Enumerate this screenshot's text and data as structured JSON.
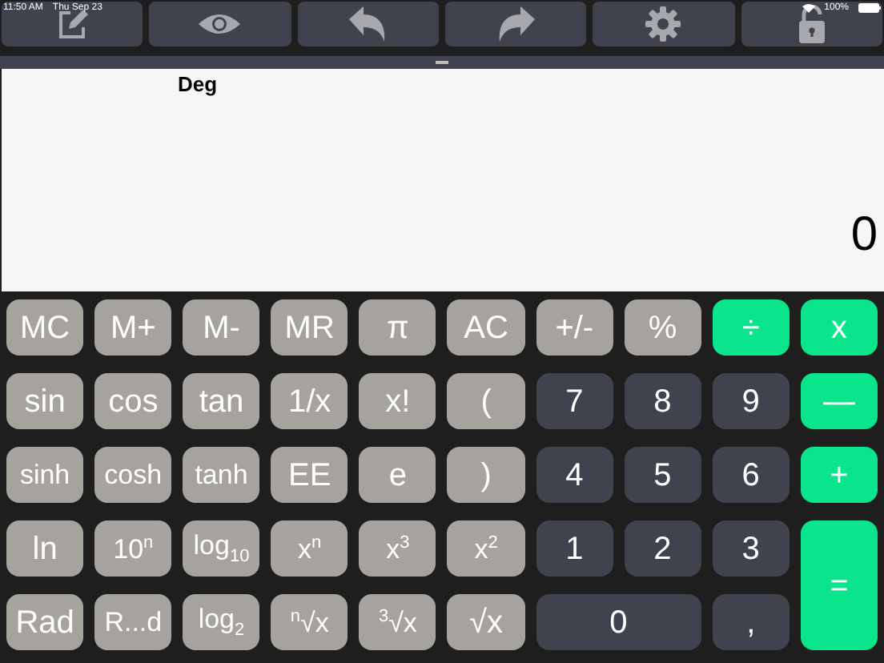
{
  "status_bar": {
    "time": "11:50 AM",
    "date": "Thu Sep 23",
    "battery": "100%"
  },
  "display": {
    "mode": "Deg",
    "value": "0"
  },
  "keys": [
    {
      "label": "MC",
      "kind": "func"
    },
    {
      "label": "M+",
      "kind": "func"
    },
    {
      "label": "M-",
      "kind": "func"
    },
    {
      "label": "MR",
      "kind": "func"
    },
    {
      "label": "π",
      "kind": "func"
    },
    {
      "label": "AC",
      "kind": "func"
    },
    {
      "label": "+/-",
      "kind": "func"
    },
    {
      "label": "%",
      "kind": "func"
    },
    {
      "label": "÷",
      "kind": "op"
    },
    {
      "label": "x",
      "kind": "op"
    },
    {
      "label": "sin",
      "kind": "func"
    },
    {
      "label": "cos",
      "kind": "func"
    },
    {
      "label": "tan",
      "kind": "func"
    },
    {
      "label": "1/x",
      "kind": "func"
    },
    {
      "label": "x!",
      "kind": "func"
    },
    {
      "label": "(",
      "kind": "func"
    },
    {
      "label": "7",
      "kind": "num"
    },
    {
      "label": "8",
      "kind": "num"
    },
    {
      "label": "9",
      "kind": "num"
    },
    {
      "label": "—",
      "kind": "op"
    },
    {
      "label": "sinh",
      "kind": "func"
    },
    {
      "label": "cosh",
      "kind": "func"
    },
    {
      "label": "tanh",
      "kind": "func"
    },
    {
      "label": "EE",
      "kind": "func"
    },
    {
      "label": "e",
      "kind": "func"
    },
    {
      "label": ")",
      "kind": "func"
    },
    {
      "label": "4",
      "kind": "num"
    },
    {
      "label": "5",
      "kind": "num"
    },
    {
      "label": "6",
      "kind": "num"
    },
    {
      "label": "+",
      "kind": "op"
    },
    {
      "label": "ln",
      "kind": "func"
    },
    {
      "label": "10$^{n}$",
      "kind": "func"
    },
    {
      "label": "log$_{10}$",
      "kind": "func"
    },
    {
      "label": "x$^{n}$",
      "kind": "func"
    },
    {
      "label": "x$^{3}$",
      "kind": "func"
    },
    {
      "label": "x$^{2}$",
      "kind": "func"
    },
    {
      "label": "1",
      "kind": "num"
    },
    {
      "label": "2",
      "kind": "num"
    },
    {
      "label": "3",
      "kind": "num"
    },
    {
      "label": "=",
      "kind": "op_tall"
    },
    {
      "label": "Rad",
      "kind": "func"
    },
    {
      "label": "R...d",
      "kind": "func"
    },
    {
      "label": "log$_{2}$",
      "kind": "func"
    },
    {
      "label": "$^{n}$√x",
      "kind": "func"
    },
    {
      "label": "$^{3}$√x",
      "kind": "func"
    },
    {
      "label": "√x",
      "kind": "func"
    },
    {
      "label": "0",
      "kind": "num_wide"
    },
    {
      "label": ",",
      "kind": "num"
    }
  ]
}
